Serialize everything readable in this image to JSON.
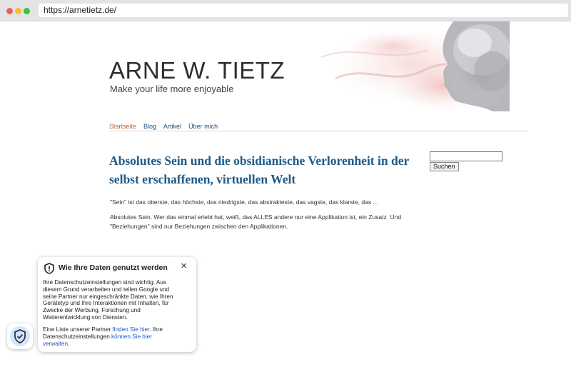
{
  "browser": {
    "url": "https://arnetietz.de/"
  },
  "site": {
    "title": "ARNE W. TIETZ",
    "tagline": "Make your life more enjoyable"
  },
  "nav": {
    "items": [
      {
        "label": "Startseite",
        "active": true
      },
      {
        "label": "Blog",
        "active": false
      },
      {
        "label": "Artikel",
        "active": false
      },
      {
        "label": "Über mich",
        "active": false
      }
    ]
  },
  "post": {
    "title": "Absolutes Sein und die obsidianische Verlorenheit in der selbst erschaffenen, virtuellen Welt",
    "paragraph1": "\"Sein\" ist das oberste, das höchste, das niedrigste, das abstrakteste, das vagste, das klarste, das ...",
    "paragraph2": "Absolutes Sein. Wer das einmal erlebt hat, weiß, das ALLES andere nur eine Applikation ist, ein Zusatz. Und \"Beziehungen\" sind nur Beziehungen zwischen den Applikationen."
  },
  "search": {
    "value": "",
    "button_label": "Suchen"
  },
  "consent": {
    "title": "Wie Ihre Daten genutzt werden",
    "close_symbol": "✕",
    "body": "Ihre Datenschutzeinstellungen sind wichtig. Aus diesem Grund verarbeiten und teilen Google und seine Partner nur eingeschränkte Daten, wie Ihren Gerätetyp und Ihre Interaktionen mit Inhalten, für Zwecke der Werbung, Forschung und Weiterentwicklung von Diensten.",
    "partners_prefix": "Eine Liste unserer Partner ",
    "partners_link": "finden Sie hier",
    "settings_prefix": ". Ihre Datenschutzeinstellungen ",
    "settings_link": "können Sie hier verwalten",
    "settings_suffix": "."
  },
  "colors": {
    "link": "#1d4f7a",
    "active_nav": "#b06a3a",
    "post_title": "#1f5a86",
    "consent_link": "#1a56c4"
  }
}
